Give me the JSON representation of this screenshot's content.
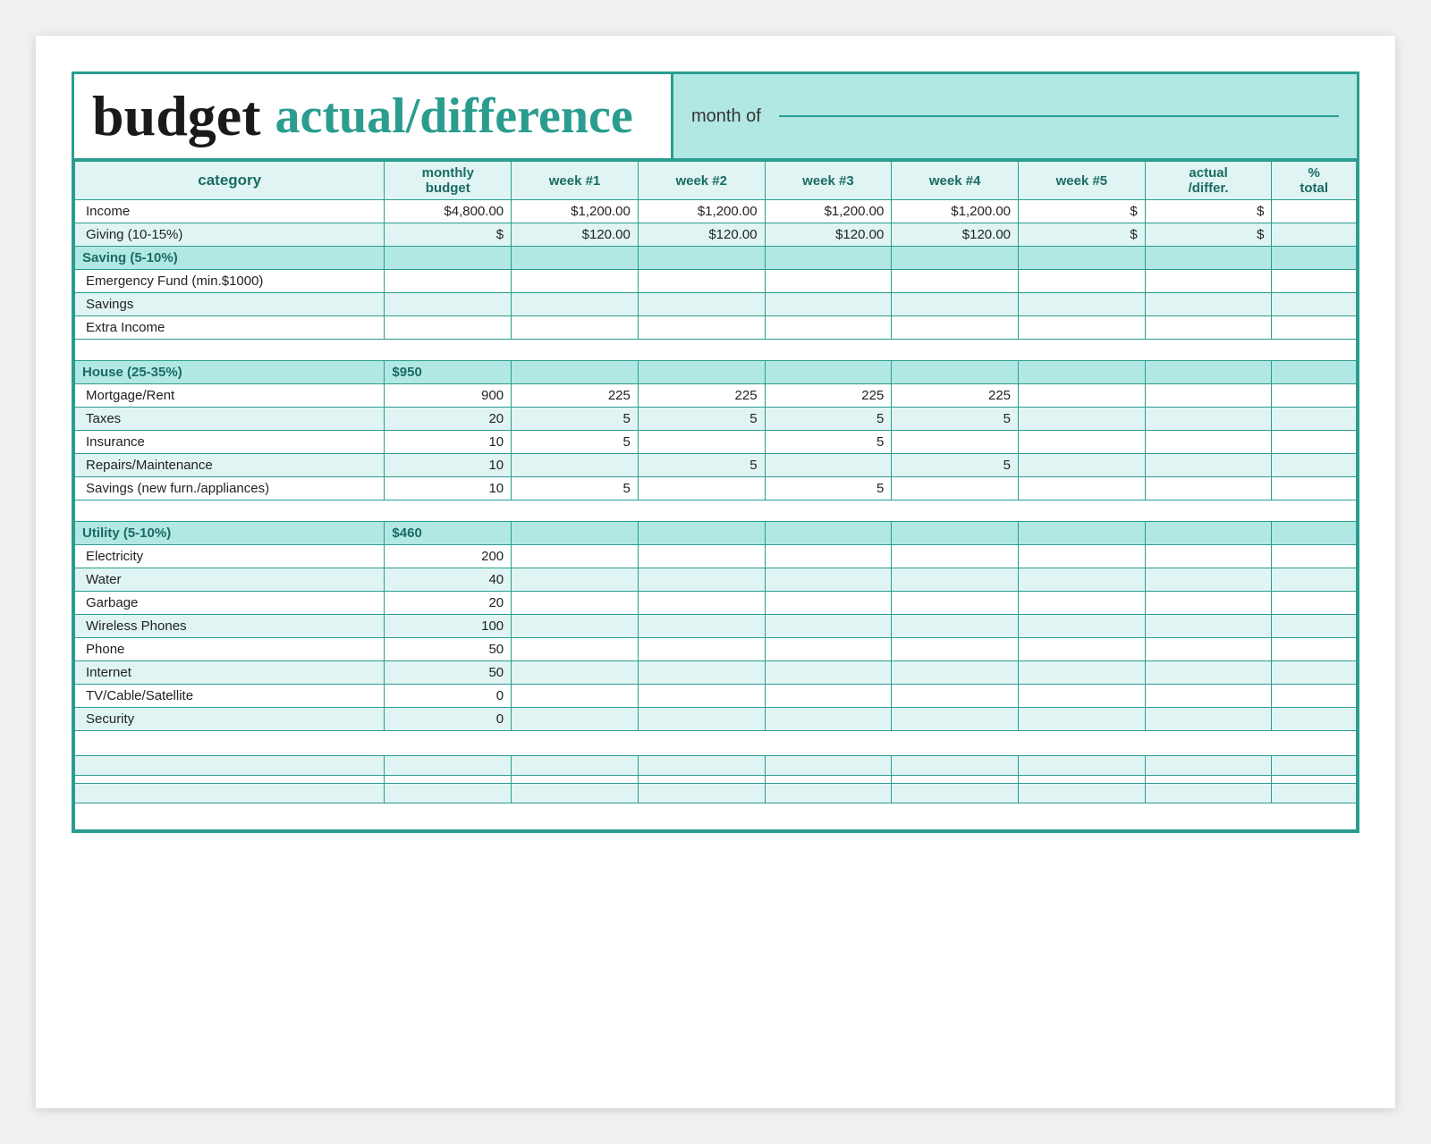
{
  "header": {
    "title_budget": "budget",
    "title_actual": "actual/difference",
    "month_label": "month of"
  },
  "columns": {
    "category": "category",
    "monthly_budget": "monthly\nbudget",
    "week1": "week #1",
    "week2": "week #2",
    "week3": "week #3",
    "week4": "week #4",
    "week5": "week #5",
    "actual_differ": "actual\n/differ.",
    "pct_total": "%\ntotal"
  },
  "sections": [
    {
      "name": "Income",
      "label": "Income",
      "budget": "$4,800.00",
      "rows": [
        {
          "category": "Income",
          "monthly_budget": "$4,800.00",
          "week1": "$1,200.00",
          "week2": "$1,200.00",
          "week3": "$1,200.00",
          "week4": "$1,200.00",
          "week5": "$",
          "actual": "$",
          "pct": ""
        }
      ]
    },
    {
      "name": "Giving",
      "label": "Giving (10-15%)",
      "rows": [
        {
          "category": "Giving (10-15%)",
          "monthly_budget": "$",
          "week1": "$120.00",
          "week2": "$120.00",
          "week3": "$120.00",
          "week4": "$120.00",
          "week5": "$",
          "actual": "$",
          "pct": ""
        }
      ]
    },
    {
      "name": "Saving",
      "label": "Saving (5-10%)",
      "is_section": true,
      "rows": [
        {
          "category": "Emergency Fund (min.$1000)",
          "monthly_budget": "",
          "week1": "",
          "week2": "",
          "week3": "",
          "week4": "",
          "week5": "",
          "actual": "",
          "pct": ""
        },
        {
          "category": "Savings",
          "monthly_budget": "",
          "week1": "",
          "week2": "",
          "week3": "",
          "week4": "",
          "week5": "",
          "actual": "",
          "pct": ""
        },
        {
          "category": "Extra Income",
          "monthly_budget": "",
          "week1": "",
          "week2": "",
          "week3": "",
          "week4": "",
          "week5": "",
          "actual": "",
          "pct": ""
        }
      ]
    },
    {
      "name": "House",
      "label": "House (25-35%)",
      "budget": "$950",
      "is_section": true,
      "rows": [
        {
          "category": "Mortgage/Rent",
          "monthly_budget": "900",
          "week1": "225",
          "week2": "225",
          "week3": "225",
          "week4": "225",
          "week5": "",
          "actual": "",
          "pct": ""
        },
        {
          "category": "Taxes",
          "monthly_budget": "20",
          "week1": "5",
          "week2": "5",
          "week3": "5",
          "week4": "5",
          "week5": "",
          "actual": "",
          "pct": ""
        },
        {
          "category": "Insurance",
          "monthly_budget": "10",
          "week1": "5",
          "week2": "",
          "week3": "5",
          "week4": "",
          "week5": "",
          "actual": "",
          "pct": ""
        },
        {
          "category": "Repairs/Maintenance",
          "monthly_budget": "10",
          "week1": "",
          "week2": "5",
          "week3": "",
          "week4": "5",
          "week5": "",
          "actual": "",
          "pct": ""
        },
        {
          "category": "Savings (new furn./appliances)",
          "monthly_budget": "10",
          "week1": "5",
          "week2": "",
          "week3": "5",
          "week4": "",
          "week5": "",
          "actual": "",
          "pct": ""
        }
      ]
    },
    {
      "name": "Utility",
      "label": "Utility (5-10%)",
      "budget": "$460",
      "is_section": true,
      "rows": [
        {
          "category": "Electricity",
          "monthly_budget": "200",
          "week1": "",
          "week2": "",
          "week3": "",
          "week4": "",
          "week5": "",
          "actual": "",
          "pct": ""
        },
        {
          "category": "Water",
          "monthly_budget": "40",
          "week1": "",
          "week2": "",
          "week3": "",
          "week4": "",
          "week5": "",
          "actual": "",
          "pct": ""
        },
        {
          "category": "Garbage",
          "monthly_budget": "20",
          "week1": "",
          "week2": "",
          "week3": "",
          "week4": "",
          "week5": "",
          "actual": "",
          "pct": ""
        },
        {
          "category": "Wireless Phones",
          "monthly_budget": "100",
          "week1": "",
          "week2": "",
          "week3": "",
          "week4": "",
          "week5": "",
          "actual": "",
          "pct": ""
        },
        {
          "category": "Phone",
          "monthly_budget": "50",
          "week1": "",
          "week2": "",
          "week3": "",
          "week4": "",
          "week5": "",
          "actual": "",
          "pct": ""
        },
        {
          "category": "Internet",
          "monthly_budget": "50",
          "week1": "",
          "week2": "",
          "week3": "",
          "week4": "",
          "week5": "",
          "actual": "",
          "pct": ""
        },
        {
          "category": "TV/Cable/Satellite",
          "monthly_budget": "0",
          "week1": "",
          "week2": "",
          "week3": "",
          "week4": "",
          "week5": "",
          "actual": "",
          "pct": ""
        },
        {
          "category": "Security",
          "monthly_budget": "0",
          "week1": "",
          "week2": "",
          "week3": "",
          "week4": "",
          "week5": "",
          "actual": "",
          "pct": ""
        }
      ]
    }
  ]
}
